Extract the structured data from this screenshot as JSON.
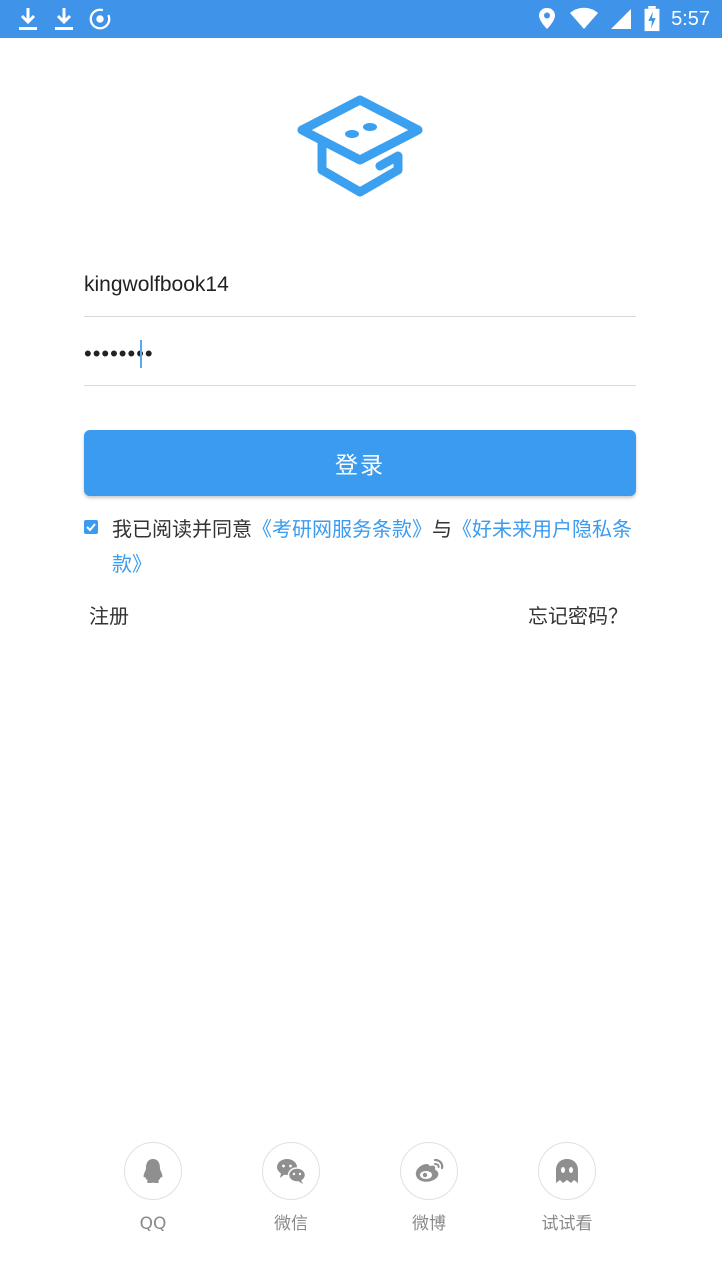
{
  "status_bar": {
    "time": "5:57",
    "left_icons": [
      "download-icon",
      "download-icon",
      "nox-icon"
    ],
    "right_icons": [
      "location-icon",
      "wifi-icon",
      "signal-icon",
      "battery-charging-icon"
    ]
  },
  "login": {
    "username_value": "kingwolfbook14",
    "password_value": "••••••••",
    "login_label": "登录"
  },
  "agreement": {
    "checked": true,
    "prefix": "我已阅读并同意",
    "link1": "《考研网服务条款》",
    "connector": "与",
    "link2": "《好未来用户隐私条款》"
  },
  "links": {
    "register": "注册",
    "forgot": "忘记密码？"
  },
  "social": [
    {
      "label": "QQ",
      "icon": "qq-icon"
    },
    {
      "label": "微信",
      "icon": "wechat-icon"
    },
    {
      "label": "微博",
      "icon": "weibo-icon"
    },
    {
      "label": "试试看",
      "icon": "ghost-icon"
    }
  ],
  "colors": {
    "status_bar": "#3f94e9",
    "accent": "#3a9bef",
    "muted_icon": "#8f8f8f"
  }
}
